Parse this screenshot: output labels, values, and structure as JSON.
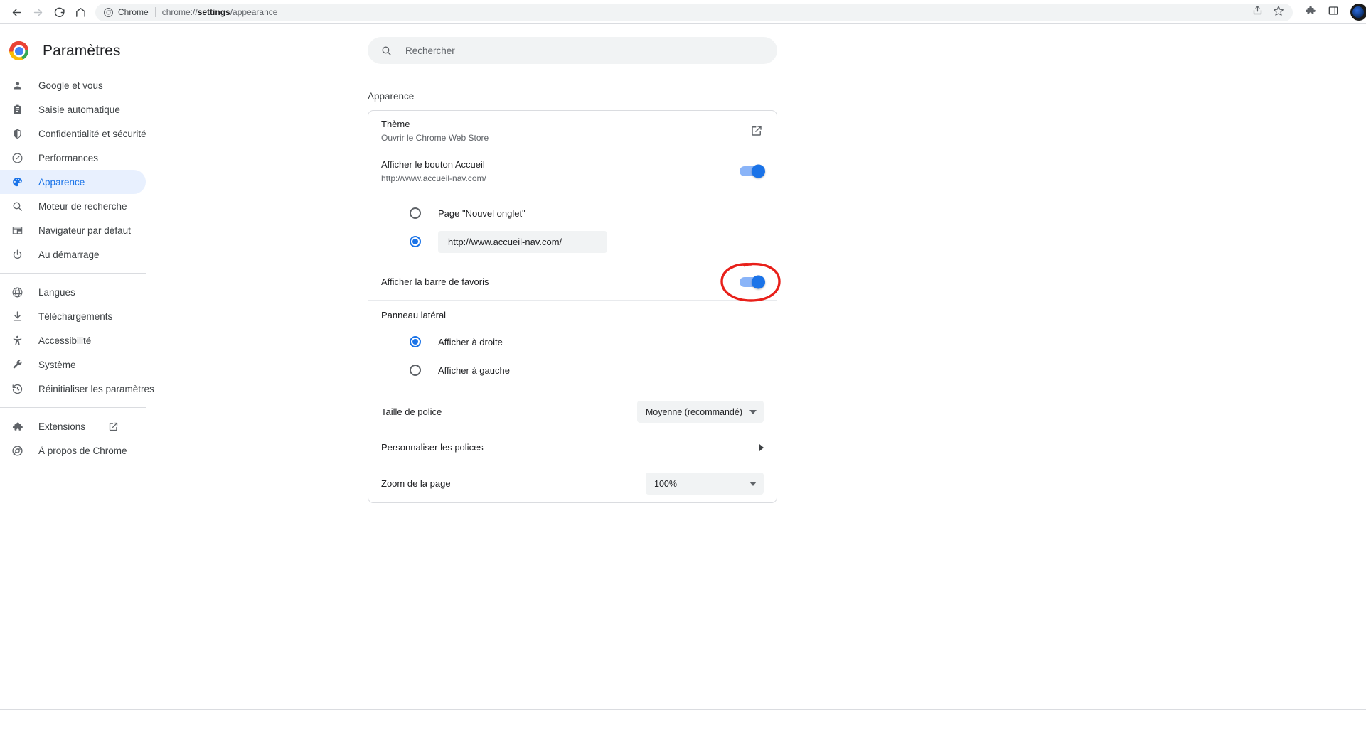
{
  "browser": {
    "back_icon": "back-arrow-icon",
    "forward_icon": "forward-arrow-icon",
    "reload_icon": "reload-icon",
    "home_icon": "home-icon",
    "site_chip_label": "Chrome",
    "url_prefix": "chrome://",
    "url_bold": "settings",
    "url_suffix": "/appearance",
    "share_icon": "share-icon",
    "bookmark_icon": "star-icon",
    "extensions_icon": "puzzle-piece-icon",
    "side_panel_icon": "side-panel-icon",
    "profile_icon": "profile-avatar-icon"
  },
  "sidebar": {
    "brand_title": "Paramètres",
    "logo_icon": "chrome-logo-icon",
    "items": [
      {
        "label": "Google et vous",
        "icon": "person-icon",
        "active": false
      },
      {
        "label": "Saisie automatique",
        "icon": "clipboard-icon",
        "active": false
      },
      {
        "label": "Confidentialité et sécurité",
        "icon": "shield-icon",
        "active": false
      },
      {
        "label": "Performances",
        "icon": "speedometer-icon",
        "active": false
      },
      {
        "label": "Apparence",
        "icon": "palette-icon",
        "active": true
      },
      {
        "label": "Moteur de recherche",
        "icon": "search-icon",
        "active": false
      },
      {
        "label": "Navigateur par défaut",
        "icon": "browser-icon",
        "active": false
      },
      {
        "label": "Au démarrage",
        "icon": "power-icon",
        "active": false
      }
    ],
    "items2": [
      {
        "label": "Langues",
        "icon": "globe-icon"
      },
      {
        "label": "Téléchargements",
        "icon": "download-icon"
      },
      {
        "label": "Accessibilité",
        "icon": "accessibility-icon"
      },
      {
        "label": "Système",
        "icon": "wrench-icon"
      },
      {
        "label": "Réinitialiser les paramètres",
        "icon": "history-restore-icon"
      }
    ],
    "items3": [
      {
        "label": "Extensions",
        "icon": "puzzle-piece-icon",
        "external": true
      },
      {
        "label": "À propos de Chrome",
        "icon": "chrome-outline-icon",
        "external": false
      }
    ]
  },
  "search": {
    "placeholder": "Rechercher",
    "value": "",
    "icon": "search-icon"
  },
  "main": {
    "section_title": "Apparence",
    "rows": {
      "theme": {
        "title": "Thème",
        "subtitle": "Ouvrir le Chrome Web Store",
        "action_icon": "open-in-new-icon"
      },
      "home_button": {
        "title": "Afficher le bouton Accueil",
        "subtitle": "http://www.accueil-nav.com/",
        "toggle_on": true
      },
      "home_options": [
        {
          "label": "Page \"Nouvel onglet\"",
          "selected": false,
          "is_pill": false
        },
        {
          "label": "http://www.accueil-nav.com/",
          "selected": true,
          "is_pill": true
        }
      ],
      "bookmarks_bar": {
        "title": "Afficher la barre de favoris",
        "toggle_on": true,
        "annotated": true
      },
      "side_panel": {
        "title": "Panneau latéral",
        "options": [
          {
            "label": "Afficher à droite",
            "selected": true
          },
          {
            "label": "Afficher à gauche",
            "selected": false
          }
        ]
      },
      "font_size": {
        "title": "Taille de police",
        "value": "Moyenne (recommandé)"
      },
      "customize_fonts": {
        "title": "Personnaliser les polices",
        "action_icon": "chevron-right-icon"
      },
      "page_zoom": {
        "title": "Zoom de la page",
        "value": "100%"
      }
    }
  },
  "colors": {
    "accent": "#1a73e8",
    "accent_light": "#8ab4f8",
    "active_pill": "#e8f0fe",
    "annotation": "#e8201a",
    "surface": "#f1f3f4",
    "text": "#202124",
    "text_muted": "#5f6368",
    "border": "#dadce0"
  }
}
